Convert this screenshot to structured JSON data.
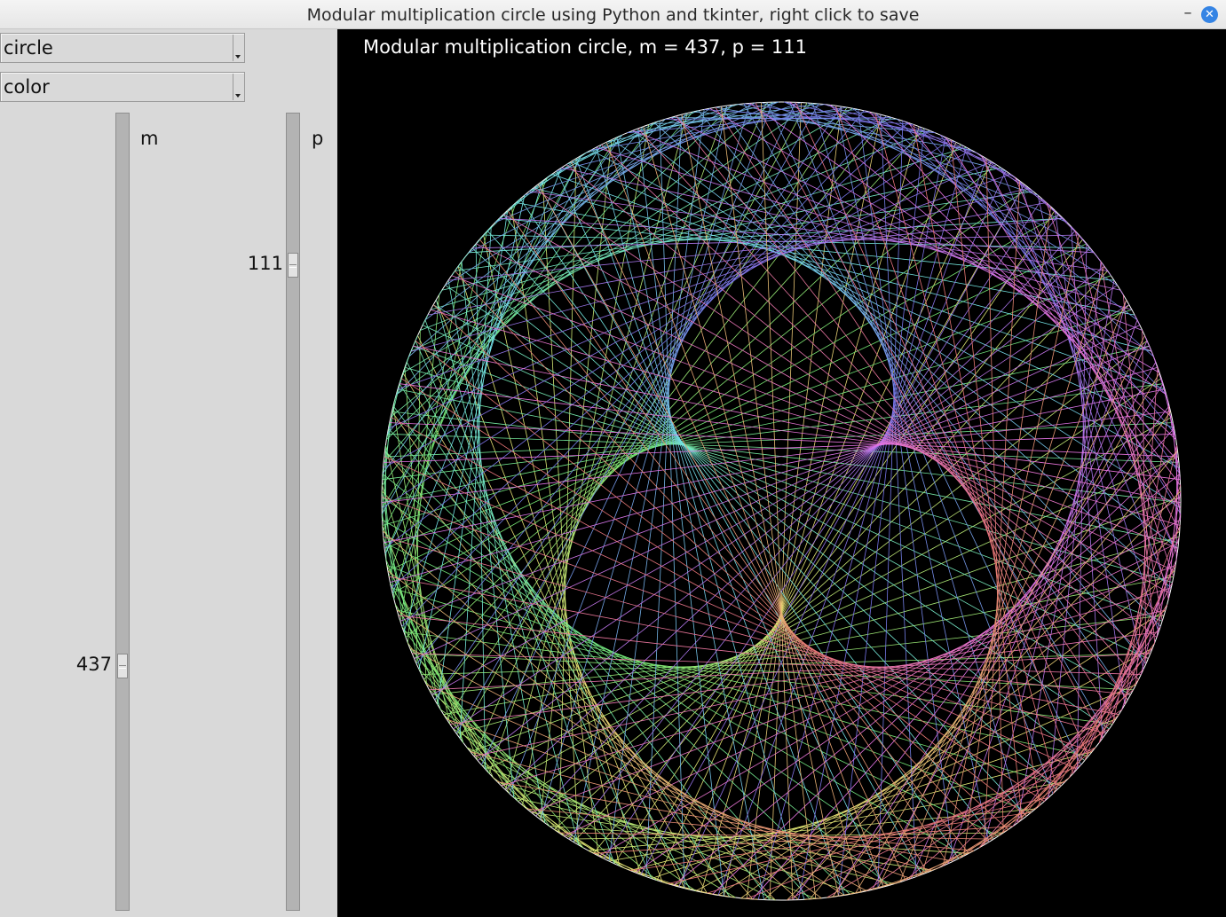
{
  "window": {
    "title": "Modular multiplication circle using Python and tkinter, right click to save",
    "minimize_glyph": "–",
    "close_glyph": "✕"
  },
  "controls": {
    "shape_select": {
      "value": "circle"
    },
    "color_select": {
      "value": "color"
    },
    "m_scale": {
      "label": "m",
      "value": "437",
      "level": 0.7
    },
    "p_scale": {
      "label": "p",
      "value": "111",
      "level": 0.18
    }
  },
  "canvas": {
    "title": "Modular multiplication circle, m = 437, p = 111",
    "background": "#000000",
    "circle_color": "#ffffff",
    "points": 437,
    "multiplier": 111
  },
  "icons": {
    "minimize": "minimize-icon",
    "close": "close-icon",
    "dropdown": "dropdown-arrow-icon"
  }
}
